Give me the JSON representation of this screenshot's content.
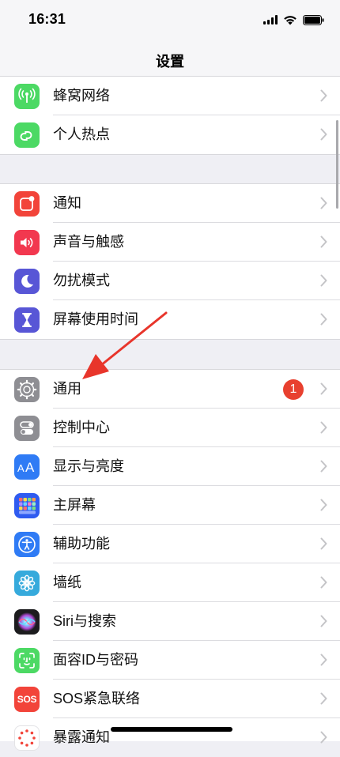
{
  "status": {
    "time": "16:31"
  },
  "nav": {
    "title": "设置"
  },
  "groups": [
    {
      "items": [
        {
          "label": "蜂窝网络",
          "icon": "cellular-antenna-icon",
          "color": "#4cd964"
        },
        {
          "label": "个人热点",
          "icon": "hotspot-link-icon",
          "color": "#4cd964"
        }
      ]
    },
    {
      "items": [
        {
          "label": "通知",
          "icon": "notifications-icon",
          "color": "#f2443a"
        },
        {
          "label": "声音与触感",
          "icon": "speaker-icon",
          "color": "#f2384f"
        },
        {
          "label": "勿扰模式",
          "icon": "moon-icon",
          "color": "#5856d6"
        },
        {
          "label": "屏幕使用时间",
          "icon": "hourglass-icon",
          "color": "#5856d6"
        }
      ]
    },
    {
      "items": [
        {
          "label": "通用",
          "icon": "gear-icon",
          "color": "#8e8e93",
          "badge": "1"
        },
        {
          "label": "控制中心",
          "icon": "toggles-icon",
          "color": "#8e8e93"
        },
        {
          "label": "显示与亮度",
          "icon": "text-size-icon",
          "color": "#2f7bf5"
        },
        {
          "label": "主屏幕",
          "icon": "app-grid-icon",
          "color": "#2f5bf0"
        },
        {
          "label": "辅助功能",
          "icon": "accessibility-icon",
          "color": "#2f7bf5"
        },
        {
          "label": "墙纸",
          "icon": "flower-icon",
          "color": "#36aadc"
        },
        {
          "label": "Siri与搜索",
          "icon": "siri-icon",
          "color": "#1c1c1e"
        },
        {
          "label": "面容ID与密码",
          "icon": "face-id-icon",
          "color": "#4cd964"
        },
        {
          "label": "SOS紧急联络",
          "icon": "sos-icon",
          "color": "#f2443a",
          "icon_text": "SOS"
        },
        {
          "label": "暴露通知",
          "icon": "exposure-icon",
          "color": "#ffffff"
        }
      ]
    }
  ]
}
